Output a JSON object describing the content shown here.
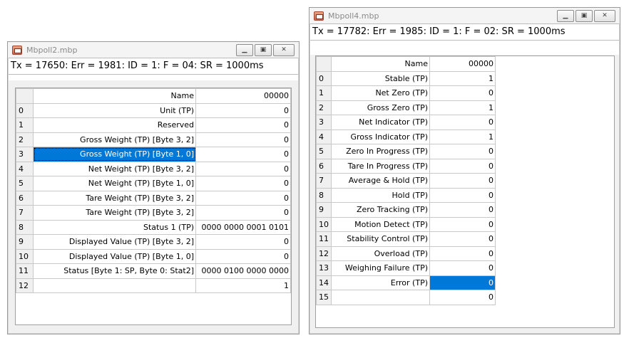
{
  "window1": {
    "title": "Mbpoll2.mbp",
    "status": "Tx = 17650: Err = 1981: ID = 1: F = 04: SR = 1000ms",
    "header": {
      "name": "Name",
      "value": "00000"
    },
    "rows": [
      {
        "num": "0",
        "name": "Unit (TP)",
        "value": "0"
      },
      {
        "num": "1",
        "name": "Reserved",
        "value": "0"
      },
      {
        "num": "2",
        "name": "Gross Weight (TP) [Byte 3, 2]",
        "value": "0"
      },
      {
        "num": "3",
        "name": "Gross Weight (TP) [Byte 1, 0]",
        "value": "0"
      },
      {
        "num": "4",
        "name": "Net Weight (TP) [Byte 3, 2]",
        "value": "0"
      },
      {
        "num": "5",
        "name": "Net Weight (TP) [Byte 1, 0]",
        "value": "0"
      },
      {
        "num": "6",
        "name": "Tare Weight (TP) [Byte 3, 2]",
        "value": "0"
      },
      {
        "num": "7",
        "name": "Tare Weight (TP) [Byte 3, 2]",
        "value": "0"
      },
      {
        "num": "8",
        "name": "Status 1 (TP)",
        "value": "0000 0000 0001 0101"
      },
      {
        "num": "9",
        "name": "Displayed Value (TP) [Byte 3, 2]",
        "value": "0"
      },
      {
        "num": "10",
        "name": "Displayed Value (TP) [Byte 1, 0]",
        "value": "0"
      },
      {
        "num": "11",
        "name": "Status  [Byte 1: SP, Byte 0: Stat2]",
        "value": "0000 0100 0000 0000"
      },
      {
        "num": "12",
        "name": "",
        "value": "1"
      }
    ]
  },
  "window2": {
    "title": "Mbpoll4.mbp",
    "status": "Tx = 17782: Err = 1985: ID = 1: F = 02: SR = 1000ms",
    "header": {
      "name": "Name",
      "value": "00000"
    },
    "rows": [
      {
        "num": "0",
        "name": "Stable (TP)",
        "value": "1"
      },
      {
        "num": "1",
        "name": "Net Zero (TP)",
        "value": "0"
      },
      {
        "num": "2",
        "name": "Gross Zero (TP)",
        "value": "1"
      },
      {
        "num": "3",
        "name": "Net Indicator (TP)",
        "value": "0"
      },
      {
        "num": "4",
        "name": "Gross Indicator (TP)",
        "value": "1"
      },
      {
        "num": "5",
        "name": "Zero In Progress (TP)",
        "value": "0"
      },
      {
        "num": "6",
        "name": "Tare In Progress (TP)",
        "value": "0"
      },
      {
        "num": "7",
        "name": "Average & Hold (TP)",
        "value": "0"
      },
      {
        "num": "8",
        "name": "Hold (TP)",
        "value": "0"
      },
      {
        "num": "9",
        "name": "Zero Tracking (TP)",
        "value": "0"
      },
      {
        "num": "10",
        "name": "Motion Detect (TP)",
        "value": "0"
      },
      {
        "num": "11",
        "name": "Stability Control (TP)",
        "value": "0"
      },
      {
        "num": "12",
        "name": "Overload (TP)",
        "value": "0"
      },
      {
        "num": "13",
        "name": "Weighing Failure (TP)",
        "value": "0"
      },
      {
        "num": "14",
        "name": "Error (TP)",
        "value": "0"
      },
      {
        "num": "15",
        "name": "",
        "value": "0"
      }
    ]
  },
  "icons": {
    "app": "app-icon",
    "minimize": "minimize-icon",
    "maximize": "maximize-icon",
    "close": "close-icon"
  },
  "colors": {
    "selection": "#0078d7"
  }
}
